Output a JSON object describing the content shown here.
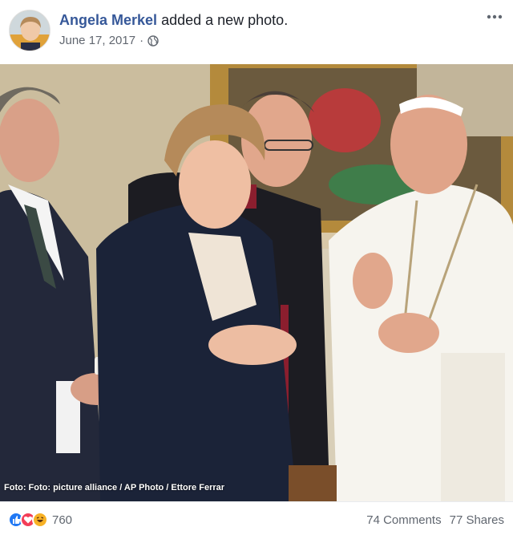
{
  "post": {
    "author": "Angela Merkel",
    "action": "added a new photo.",
    "date": "June 17, 2017",
    "separator": "·",
    "privacy_icon": "globe-icon",
    "more_icon": "three-dots-icon"
  },
  "photo": {
    "credit": "Foto: Foto: picture alliance / AP Photo / Ettore Ferrar"
  },
  "footer": {
    "reaction_icons": [
      "like-icon",
      "love-icon",
      "haha-icon"
    ],
    "reaction_count": "760",
    "comments": "74 Comments",
    "shares": "77 Shares"
  },
  "colors": {
    "link": "#365899",
    "meta": "#616770",
    "like": "#2078f4",
    "love": "#f33e58",
    "haha": "#f7b125"
  }
}
